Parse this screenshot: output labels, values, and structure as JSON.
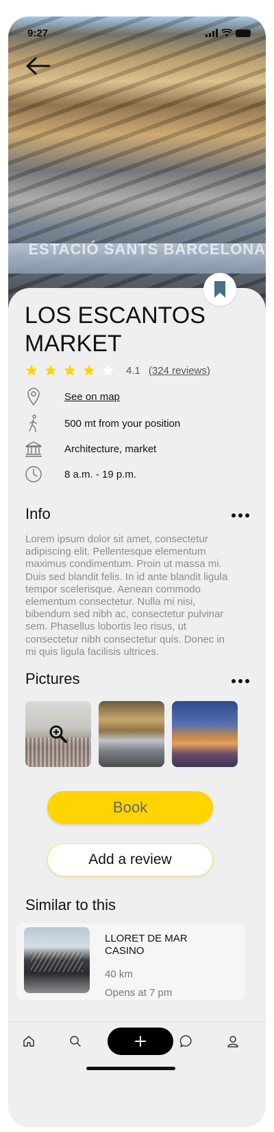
{
  "status_bar": {
    "time": "9:27"
  },
  "place": {
    "name": "LOS ESCANTOS MARKET",
    "hero_sign": "ESTACIÓ SANTS BARCELONA",
    "rating": 4.1,
    "rating_text": "4.1",
    "reviews_text": "(324 reviews)",
    "stars_filled": 4,
    "stars_total": 5,
    "details": {
      "map_link": "See on map",
      "distance": "500 mt from your position",
      "category": "Architecture, market",
      "hours": "8 a.m. - 19 p.m."
    }
  },
  "info": {
    "title": "Info",
    "text": "Lorem ipsum dolor sit amet, consectetur adipiscing elit. Pellentesque elementum maximus condimentum. Proin ut massa mi. Duis sed blandit felis. In id ante blandit ligula tempor scelerisque. Aenean commodo elementum consectetur. Nulla mi nisi, bibendum sed nibh ac, consectetur pulvinar sem. Phasellus lobortis leo risus, ut consectetur nibh consectetur quis. Donec in mi quis ligula facilisis ultrices."
  },
  "pictures": {
    "title": "Pictures"
  },
  "actions": {
    "book_label": "Book",
    "review_label": "Add a review"
  },
  "similar": {
    "title": "Similar to this",
    "items": [
      {
        "name": "LLORET DE MAR CASINO",
        "distance": "40 km",
        "hours": "Opens at 7 pm"
      }
    ]
  },
  "tabbar": {
    "items": [
      "home-icon",
      "search-icon",
      "plus-icon",
      "chat-icon",
      "profile-icon"
    ]
  },
  "colors": {
    "accent": "#ffd400",
    "bookmark": "#4a6e86",
    "background": "#efefef"
  }
}
